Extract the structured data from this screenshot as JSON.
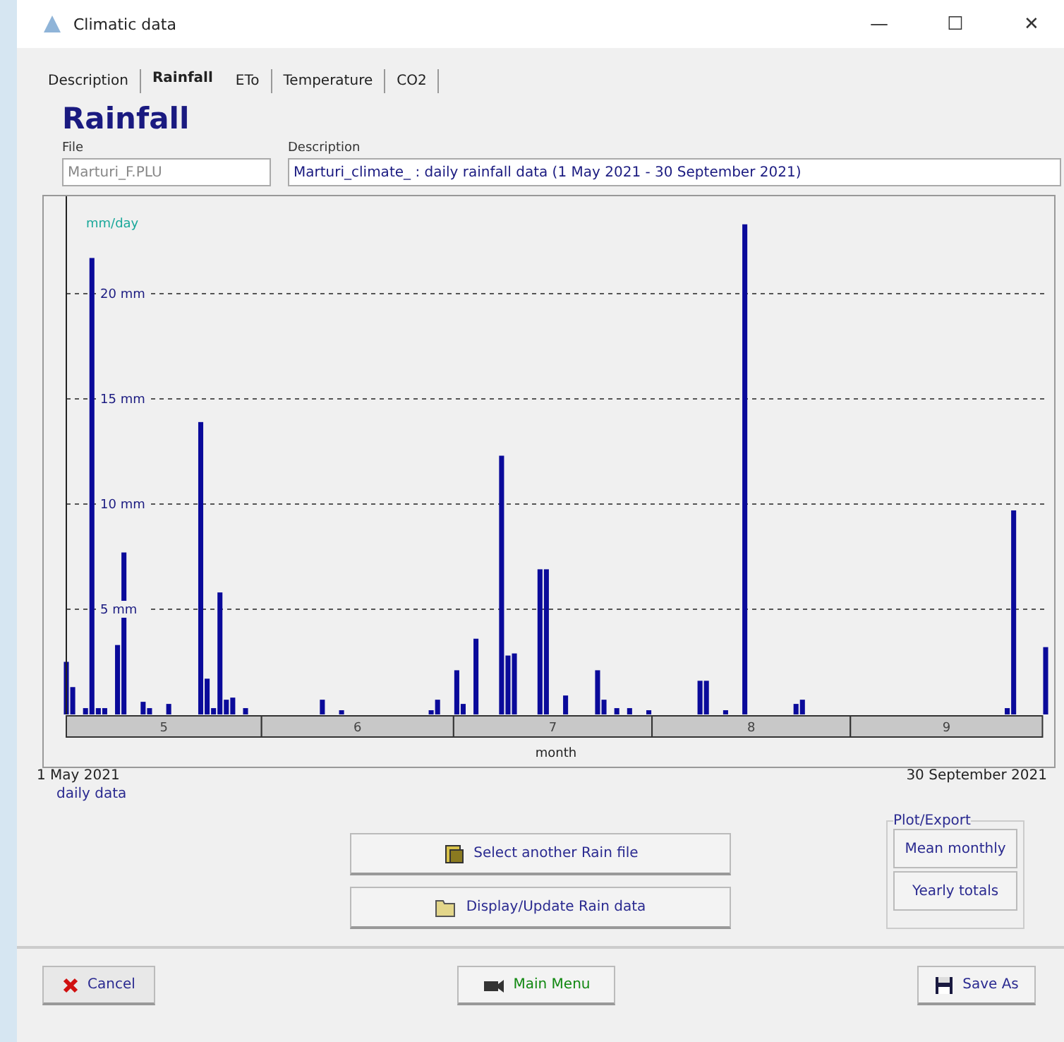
{
  "window": {
    "title": "Climatic data",
    "controls": [
      "—",
      "☐",
      "✕"
    ]
  },
  "tabs": [
    {
      "label": "Description",
      "selected": false
    },
    {
      "label": "Rainfall",
      "selected": true
    },
    {
      "label": "ETo",
      "selected": false
    },
    {
      "label": "Temperature",
      "selected": false
    },
    {
      "label": "CO2",
      "selected": false
    }
  ],
  "rainfall": {
    "heading": "Rainfall",
    "file": {
      "label": "File",
      "value": "Marturi_F.PLU",
      "disabled": true
    },
    "description": {
      "label": "Description",
      "value": "Marturi_climate_ : daily rainfall data (1 May 2021 - 30 September 2021)"
    },
    "chart_data": {
      "type": "bar",
      "xlabel": "month",
      "ylabel": "mm/day",
      "ylim": [
        0,
        24.5
      ],
      "grid": true,
      "yticks": [
        {
          "value": 5,
          "label": "5 mm"
        },
        {
          "value": 10,
          "label": "10 mm"
        },
        {
          "value": 15,
          "label": "15 mm"
        },
        {
          "value": 20,
          "label": "20 mm"
        }
      ],
      "values": [
        2.5,
        1.3,
        0,
        0.3,
        21.7,
        0.3,
        0.3,
        0,
        3.3,
        7.7,
        0,
        0,
        0.6,
        0.3,
        0,
        0,
        0.5,
        0,
        0,
        0,
        0,
        13.9,
        1.7,
        0.3,
        5.8,
        0.7,
        0.8,
        0,
        0.3,
        0,
        0,
        0,
        0,
        0,
        0,
        0,
        0,
        0,
        0,
        0,
        0.7,
        0,
        0,
        0.2,
        0,
        0,
        0,
        0,
        0,
        0,
        0,
        0,
        0,
        0,
        0,
        0,
        0,
        0.2,
        0.7,
        0,
        0,
        2.1,
        0.5,
        0,
        3.6,
        0,
        0,
        0,
        12.3,
        2.8,
        2.9,
        0,
        0,
        0,
        6.9,
        6.9,
        0,
        0,
        0.9,
        0,
        0,
        0,
        0,
        2.1,
        0.7,
        0,
        0.3,
        0,
        0.3,
        0,
        0,
        0.2,
        0,
        0,
        0,
        0,
        0,
        0,
        0,
        1.6,
        1.6,
        0,
        0,
        0.2,
        0,
        0,
        23.3,
        0,
        0,
        0,
        0,
        0,
        0,
        0,
        0.5,
        0.7,
        0,
        0,
        0,
        0,
        0,
        0,
        0,
        0,
        0,
        0,
        0,
        0,
        0,
        0,
        0,
        0,
        0,
        0,
        0,
        0,
        0,
        0,
        0,
        0,
        0,
        0,
        0,
        0,
        0,
        0,
        0,
        0.3,
        9.7,
        0,
        0,
        0,
        0,
        3.2
      ]
    },
    "month_labels": [
      "5",
      "6",
      "7",
      "8",
      "9"
    ],
    "start_date": "1 May 2021",
    "resolution": "daily data",
    "end_date": "30 September 2021",
    "actions": [
      "Select another Rain file",
      "Display/Update Rain data"
    ],
    "plot_export": {
      "title": "Plot/Export",
      "buttons": [
        "Mean monthly",
        "Yearly totals"
      ]
    }
  },
  "footer": [
    {
      "label": "Cancel",
      "kind": "cancel"
    },
    {
      "label": "Main Menu",
      "kind": "menu"
    },
    {
      "label": "Save As",
      "kind": "save"
    }
  ]
}
